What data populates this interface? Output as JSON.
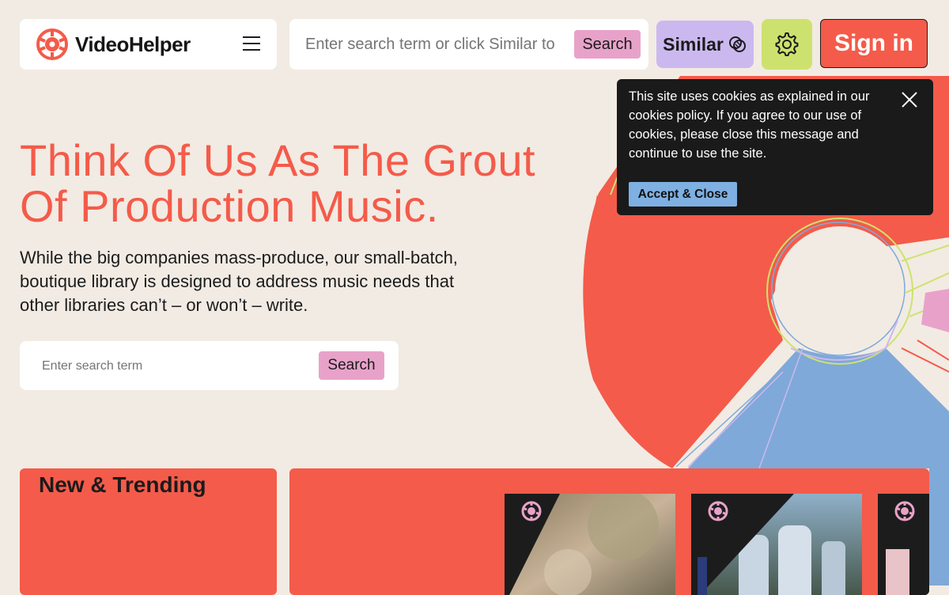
{
  "header": {
    "logo_text": "VideoHelper",
    "menu_icon": "hamburger-icon",
    "search_placeholder": "Enter search term or click Similar to upload a reference track",
    "search_button": "Search",
    "similar_button": "Similar",
    "similar_icon": "overlap-circles-icon",
    "settings_icon": "gear-icon",
    "signin_button": "Sign in"
  },
  "hero": {
    "title": "Think Of Us As The Grout Of Production Music.",
    "subtitle": "While the big companies mass-produce, our small-batch, boutique library is designed to address music needs that other libraries can’t – or won’t – write.",
    "search_placeholder": "Enter search term",
    "search_button": "Search"
  },
  "cookie": {
    "text": "This site uses cookies as explained in our cookies policy. If you agree to our use of cookies, please close this message and continue to use the site.",
    "accept_button": "Accept & Close",
    "close_icon": "close-icon"
  },
  "trending": {
    "title": "New & Trending",
    "cards": [
      {
        "badge_icon": "logo-badge-icon"
      },
      {
        "badge_icon": "logo-badge-icon"
      },
      {
        "badge_icon": "logo-badge-icon"
      }
    ]
  },
  "colors": {
    "background": "#f2ebe3",
    "accent_red": "#f45b4a",
    "pink": "#e8a2c9",
    "lavender": "#cbb8ef",
    "lime": "#cde26e",
    "blue": "#7eb0e2",
    "dark": "#1a1a1a"
  }
}
